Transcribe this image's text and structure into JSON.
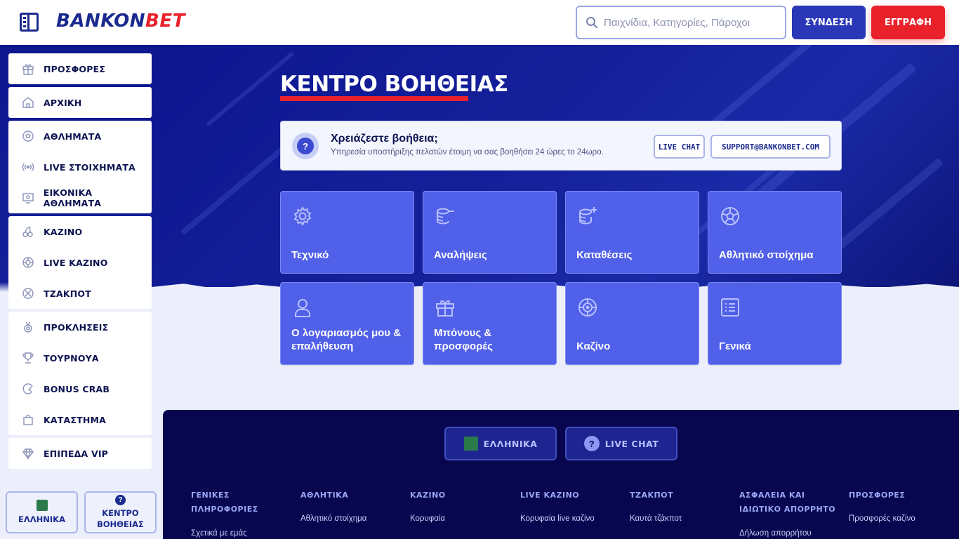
{
  "header": {
    "logo_part1": "BANKON",
    "logo_part2": "BET",
    "search_placeholder": "Παιχνίδια, Κατηγορίες, Πάροχοι",
    "login_label": "ΣΥΝΔΕΣΗ",
    "register_label": "ΕΓΓΡΑΦΗ"
  },
  "sidebar": {
    "groups": [
      [
        {
          "label": "ΠΡΟΣΦΟΡΕΣ",
          "icon": "gift-icon"
        }
      ],
      [
        {
          "label": "ΑΡΧΙΚΗ",
          "icon": "home-icon"
        }
      ],
      [
        {
          "label": "ΑΘΛΗΜΑΤΑ",
          "icon": "soccer-ball-icon"
        },
        {
          "label": "LIVE ΣΤΟΙΧΗΜΑΤΑ",
          "icon": "broadcast-icon"
        },
        {
          "label": "ΕΙΚΟΝΙΚΑ ΑΘΛΗΜΑΤΑ",
          "icon": "monitor-icon"
        }
      ],
      [
        {
          "label": "ΚΑΖΙΝΟ",
          "icon": "cherries-icon"
        },
        {
          "label": "LIVE ΚΑΖΙΝΟ",
          "icon": "roulette-icon"
        },
        {
          "label": "ΤΖΑΚΠΟΤ",
          "icon": "jackpot-icon"
        }
      ],
      [
        {
          "label": "ΠΡΟΚΛΗΣΕΙΣ",
          "icon": "medal-icon"
        },
        {
          "label": "ΤΟΥΡΝΟΥΑ",
          "icon": "trophy-icon"
        },
        {
          "label": "BONUS CRAB",
          "icon": "crab-claw-icon"
        },
        {
          "label": "ΚΑΤΑΣΤΗΜΑ",
          "icon": "shopping-bag-icon"
        }
      ],
      [
        {
          "label": "ΕΠΙΠΕΔΑ VIP",
          "icon": "diamond-icon"
        }
      ]
    ],
    "language_label": "ΕΛΛΗΝΙΚΑ",
    "help_center_label_1": "ΚΕΝΤΡΟ",
    "help_center_label_2": "ΒΟΗΘΕΙΑΣ"
  },
  "main": {
    "title": "ΚΕΝΤΡΟ ΒΟΗΘΕΙΑΣ",
    "help_card": {
      "title": "Χρειάζεστε βοήθεια;",
      "subtitle": "Υπηρεσία υποστήριξης πελατών έτοιμη να σας βοηθήσει 24 ώρες το 24ωρο.",
      "live_chat_label": "LIVE CHAT",
      "email_label": "SUPPORT@BANKONBET.COM"
    },
    "categories": [
      {
        "label": "Τεχνικό",
        "icon": "gear-icon"
      },
      {
        "label": "Αναλήψεις",
        "icon": "coins-minus-icon"
      },
      {
        "label": "Καταθέσεις",
        "icon": "coins-plus-icon"
      },
      {
        "label": "Αθλητικό στοίχημα",
        "icon": "soccer-ball-icon"
      },
      {
        "label": "Ο λογαριασμός μου & επαλήθευση",
        "icon": "user-icon"
      },
      {
        "label": "Μπόνους & προσφορές",
        "icon": "gift-icon"
      },
      {
        "label": "Καζίνο",
        "icon": "roulette-icon"
      },
      {
        "label": "Γενικά",
        "icon": "list-icon"
      }
    ]
  },
  "footer": {
    "language_label": "ΕΛΛΗΝΙΚΑ",
    "live_chat_label": "LIVE CHAT",
    "columns": [
      {
        "head1": "ΓΕΝΙΚΕΣ",
        "head2": "ΠΛΗΡΟΦΟΡΙΕΣ",
        "link": "Σχετικά με εμάς"
      },
      {
        "head1": "ΑΘΛΗΤΙΚΑ",
        "head2": "",
        "link": "Αθλητικό στοίχημα"
      },
      {
        "head1": "ΚΑΖΙΝΟ",
        "head2": "",
        "link": "Κορυφαία"
      },
      {
        "head1": "LIVE ΚΑΖΙΝΟ",
        "head2": "",
        "link": "Κορυφαία live καζίνο"
      },
      {
        "head1": "ΤΖΑΚΠΟΤ",
        "head2": "",
        "link": "Καυτά τζάκποτ"
      },
      {
        "head1": "ΑΣΦΑΛΕΙΑ ΚΑΙ",
        "head2": "ΙΔΙΩΤΙΚΟ ΑΠΟΡΡΗΤΟ",
        "link": "Δήλωση απορρήτου"
      },
      {
        "head1": "ΠΡΟΣΦΟΡΕΣ",
        "head2": "",
        "link": "Προσφορές καζίνο"
      }
    ]
  },
  "colors": {
    "brand_blue": "#1b2a8e",
    "brand_red": "#e8212b",
    "tile_blue": "#5060e8",
    "hero_blue": "#142099",
    "footer_navy": "#07064e"
  }
}
